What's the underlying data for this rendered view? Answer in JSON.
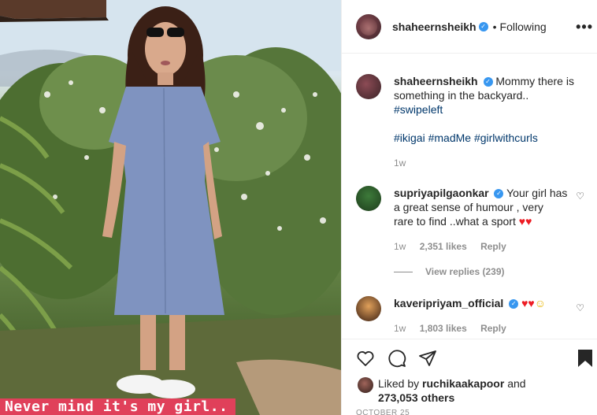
{
  "photo": {
    "caption_overlay": "Never mind it's my girl..",
    "caption_color": "#e0405a"
  },
  "post_header": {
    "username": "shaheernsheikh",
    "verified_icon": "verified-badge-icon",
    "follow_status": "Following",
    "more_icon": "more-options-icon"
  },
  "caption": {
    "username": "shaheernsheikh",
    "text_line1": "Mommy there is",
    "text_line2": "something in the backyard..",
    "hashtag_swipe": "#swipeleft",
    "hashtag_1": "#ikigai",
    "hashtag_2": "#madMe",
    "hashtag_3": "#girlwithcurls",
    "time": "1w"
  },
  "comments": [
    {
      "username": "supriyapilgaonkar",
      "text_line1": "Your girl has",
      "text_line2": "a great sense of humour , very",
      "text_line3": "rare to find ..what a sport",
      "hearts": "♥♥",
      "time": "1w",
      "likes": "2,351 likes",
      "reply": "Reply",
      "view_replies": "View replies (239)"
    },
    {
      "username": "kaveripriyam_official",
      "emojis": "♥♥",
      "smile": "☺",
      "time": "1w",
      "likes": "1,803 likes",
      "reply": "Reply"
    }
  ],
  "liked_by": {
    "prefix": "Liked by",
    "user": "ruchikaakapoor",
    "and": "and",
    "others": "273,053 others"
  },
  "date_partial": "OCTOBER 25",
  "colors": {
    "link": "#00376b",
    "verified": "#3897f0",
    "muted": "#8e8e8e",
    "heart_red": "#ed1c24"
  }
}
